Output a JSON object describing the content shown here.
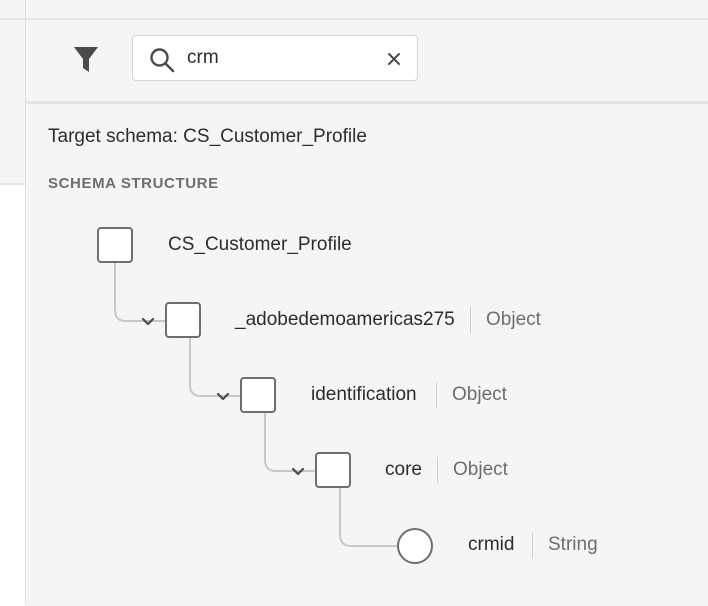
{
  "search": {
    "value": "crm",
    "placeholder": ""
  },
  "panel": {
    "target_schema_label": "Target schema: CS_Customer_Profile",
    "section_title": "SCHEMA STRUCTURE"
  },
  "tree": {
    "nodes": [
      {
        "name": "CS_Customer_Profile",
        "type": ""
      },
      {
        "name": "_adobedemoamericas275",
        "type": "Object"
      },
      {
        "name": "identification",
        "type": "Object"
      },
      {
        "name": "core",
        "type": "Object"
      },
      {
        "name": "crmid",
        "type": "String"
      }
    ]
  },
  "icons": {
    "filter": "filter-icon",
    "search": "search-icon",
    "clear": "close-icon",
    "expand": "chevron-down-icon",
    "object_node": "square-node-icon",
    "field_node": "circle-node-icon"
  },
  "colors": {
    "icon": "#4b4b4b",
    "connector": "#c8c8c8",
    "node_border": "#6e6e6e",
    "text_primary": "#2c2c2c",
    "text_secondary": "#6e6e6e"
  }
}
